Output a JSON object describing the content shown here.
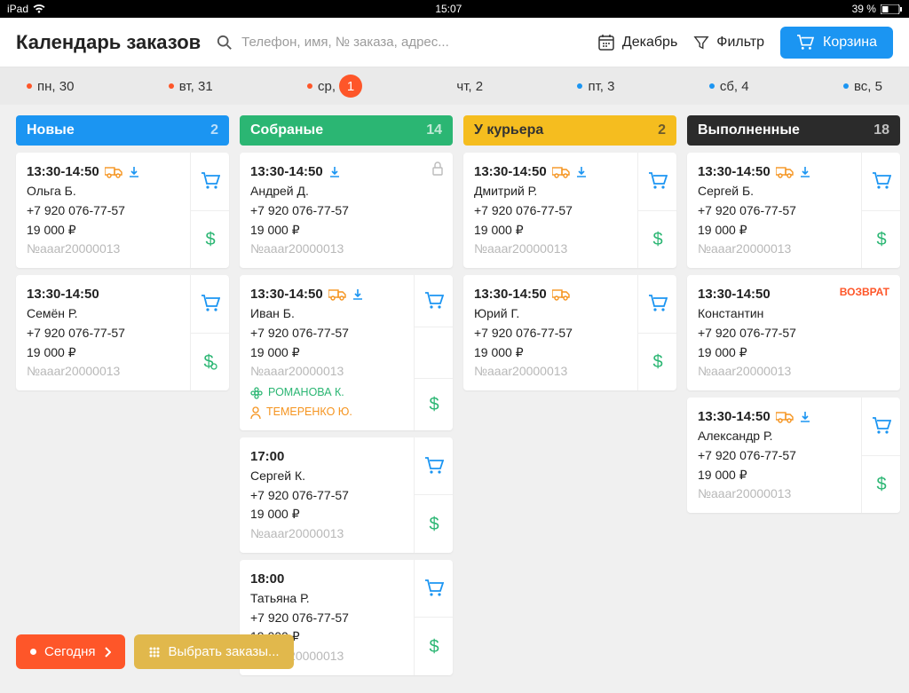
{
  "status": {
    "device": "iPad",
    "time": "15:07",
    "battery": "39 %"
  },
  "header": {
    "title": "Календарь заказов",
    "search_placeholder": "Телефон, имя, № заказа, адрес...",
    "month": "Декабрь",
    "filter": "Фильтр",
    "cart": "Корзина"
  },
  "days": [
    {
      "label": "пн, 30",
      "dot": "o"
    },
    {
      "label": "вт, 31",
      "dot": "o"
    },
    {
      "label": "ср,",
      "dot": "o",
      "badge": "1"
    },
    {
      "label": "чт, 2",
      "dot": null
    },
    {
      "label": "пт, 3",
      "dot": "b"
    },
    {
      "label": "сб, 4",
      "dot": "b"
    },
    {
      "label": "вс, 5",
      "dot": "b"
    }
  ],
  "columns": [
    {
      "title": "Новые",
      "count": "2",
      "cls": "c-blue",
      "cards": [
        {
          "time": "13:30-14:50",
          "truck": true,
          "dl": true,
          "name": "Ольга Б.",
          "phone": "+7 920 076-77-57",
          "price": "19 000 ₽",
          "num": "№aaar20000013",
          "side": [
            "cart",
            "usd"
          ]
        },
        {
          "time": "13:30-14:50",
          "name": "Семён Р.",
          "phone": "+7 920 076-77-57",
          "price": "19 000 ₽",
          "num": "№aaar20000013",
          "side": [
            "cart",
            "usd-leaf"
          ]
        }
      ]
    },
    {
      "title": "Собраные",
      "count": "14",
      "cls": "c-green",
      "cards": [
        {
          "time": "13:30-14:50",
          "dl": true,
          "lock": true,
          "name": "Андрей Д.",
          "phone": "+7 920 076-77-57",
          "price": "19 000 ₽",
          "num": "№aaar20000013"
        },
        {
          "time": "13:30-14:50",
          "truck": true,
          "dl": true,
          "name": "Иван Б.",
          "phone": "+7 920 076-77-57",
          "price": "19 000 ₽",
          "num": "№aaar20000013",
          "extra": [
            {
              "c": "g",
              "icon": "flower",
              "t": "РОМАНОВА К."
            },
            {
              "c": "or",
              "icon": "person",
              "t": "ТЕМЕРЕНКО Ю."
            }
          ],
          "side": [
            "cart",
            "",
            "usd"
          ]
        },
        {
          "time": "17:00",
          "name": "Сергей К.",
          "phone": "+7 920 076-77-57",
          "price": "19 000 ₽",
          "num": "№aaar20000013",
          "side": [
            "cart",
            "usd"
          ]
        },
        {
          "time": "18:00",
          "name": "Татьяна Р.",
          "phone": "+7 920 076-77-57",
          "price": "19 000 ₽",
          "num": "№aaar20000013",
          "side": [
            "cart",
            "usd"
          ]
        }
      ]
    },
    {
      "title": "У курьера",
      "count": "2",
      "cls": "c-yellow",
      "cards": [
        {
          "time": "13:30-14:50",
          "truck": true,
          "dl": true,
          "name": "Дмитрий Р.",
          "phone": "+7 920 076-77-57",
          "price": "19 000 ₽",
          "num": "№aaar20000013",
          "side": [
            "cart",
            "usd"
          ]
        },
        {
          "time": "13:30-14:50",
          "truck": true,
          "name": "Юрий Г.",
          "phone": "+7 920 076-77-57",
          "price": "19 000 ₽",
          "num": "№aaar20000013",
          "side": [
            "cart",
            "usd"
          ]
        }
      ]
    },
    {
      "title": "Выполненные",
      "count": "18",
      "cls": "c-dark",
      "cards": [
        {
          "time": "13:30-14:50",
          "truck": true,
          "dl": true,
          "name": "Сергей Б.",
          "phone": "+7 920 076-77-57",
          "price": "19 000 ₽",
          "num": "№aaar20000013",
          "side": [
            "cart",
            "usd"
          ]
        },
        {
          "time": "13:30-14:50",
          "ret": "ВОЗВРАТ",
          "name": "Константин",
          "phone": "+7 920 076-77-57",
          "price": "19 000 ₽",
          "num": "№aaar20000013"
        },
        {
          "time": "13:30-14:50",
          "truck": true,
          "dl": true,
          "name": "Александр Р.",
          "phone": "+7 920 076-77-57",
          "price": "19 000 ₽",
          "num": "№aaar20000013",
          "side": [
            "cart",
            "usd"
          ]
        }
      ]
    }
  ],
  "bottom": {
    "today": "Сегодня",
    "select": "Выбрать заказы..."
  }
}
